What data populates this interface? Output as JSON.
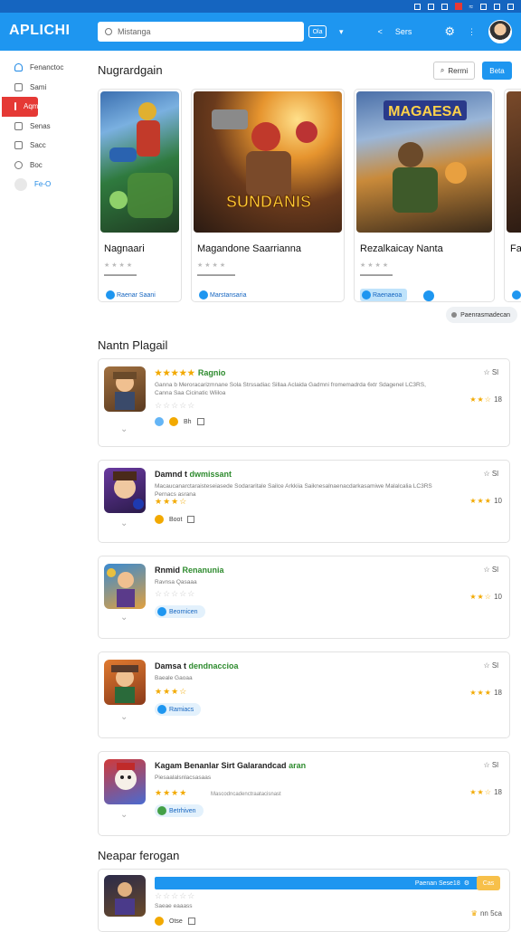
{
  "app": {
    "logo": "APLICHI"
  },
  "search": {
    "placeholder": "Mistanga"
  },
  "topbar": {
    "badge": "Ola",
    "link_label": "Sers"
  },
  "sidebar": {
    "items": [
      {
        "label": "Fenanctoc",
        "icon": "home-icon"
      },
      {
        "label": "Sami",
        "icon": "image-icon"
      },
      {
        "label": "Aqmanai",
        "icon": "grid-icon",
        "active": true
      },
      {
        "label": "Senas",
        "icon": "list-icon"
      },
      {
        "label": "Sacc",
        "icon": "doc-icon"
      },
      {
        "label": "Boc",
        "icon": "people-icon"
      },
      {
        "label": "Fe-O",
        "icon": "circle-icon"
      }
    ]
  },
  "featured": {
    "title": "Nugrardgain",
    "btn_outline": "Rerrni",
    "btn_blue": "Beta",
    "cards": [
      {
        "title": "Nagnaari",
        "tag": "Raenar Saani",
        "art_label": ""
      },
      {
        "title": "Magandone Saarrianna",
        "tag": "Marstansaria",
        "art_label": "SUNDANIS"
      },
      {
        "title": "Rezalkaicay Nanta",
        "tag": "Raenaeoa",
        "art_label": "MAGAESA"
      },
      {
        "title": "Fa",
        "tag": "",
        "art_label": ""
      }
    ],
    "more": "Paenrasmadecan"
  },
  "list_section": {
    "title": "Nantn Plagail",
    "rows": [
      {
        "title_bold": "Ragnio",
        "stars": "★★★★★",
        "desc": "Ganna b Meroracarizmnane Sola Strssadiac Sillaa Aclaida Gadmni fromemadrda 6xtr Sdagenel LC3RS,",
        "desc2": "Canna Saa Cicinatic Wiiloa",
        "rstars": "☆☆☆☆☆",
        "rnum": "",
        "act": "Bh",
        "right": "Sl",
        "rating": "18"
      },
      {
        "title_bold": "Damnd t ",
        "title_green": "dwmissant",
        "desc": "Macaucanarctaraisteseiasede Sodararitale Sailce Arkkiia Saiknesalnaenacdarkasamiwe Malalcalia LC3RS",
        "desc2": "Pernacs asrana",
        "rstars": "★★★☆",
        "rnum": "",
        "act": "Boot",
        "right": "Sl",
        "rating": "10"
      },
      {
        "title_bold": "Rnmid ",
        "title_green": "Renanunia",
        "desc2": "Ravnsa Qasaaa",
        "rstars": "☆☆☆☆☆",
        "chip": "Beornicen",
        "right": "Sl",
        "rating": "10"
      },
      {
        "title_bold": "Damsa t ",
        "title_green": "dendnaccioa",
        "desc2": "Baeale Gaoaa",
        "rstars": "★★★☆",
        "chip": "Ramiacs",
        "right": "Sl",
        "rating": "18"
      },
      {
        "title_bold": "Kagam Benanlar Sirt Galarandcad ",
        "title_green": "aran",
        "desc2": "Piesaalalsnlacsasaas",
        "rstars": "★★★★",
        "rmeta": "Mascodncadenctraatacisnast",
        "chip": "Betrhiven",
        "right": "Sl",
        "rating": "18"
      }
    ]
  },
  "bottom_section": {
    "title": "Neapar ferogan",
    "bar_text": "Paenan Sese ",
    "bar_num": "18",
    "yellow": "Cas",
    "rstars": "☆☆☆☆☆",
    "desc2": "Saeae eaaass",
    "act": "Otse",
    "rating_text": "nn 5ca"
  },
  "colors": {
    "primary": "#1e96f0",
    "active": "#e53935",
    "star": "#f2a900",
    "green": "#2e8b2e"
  }
}
